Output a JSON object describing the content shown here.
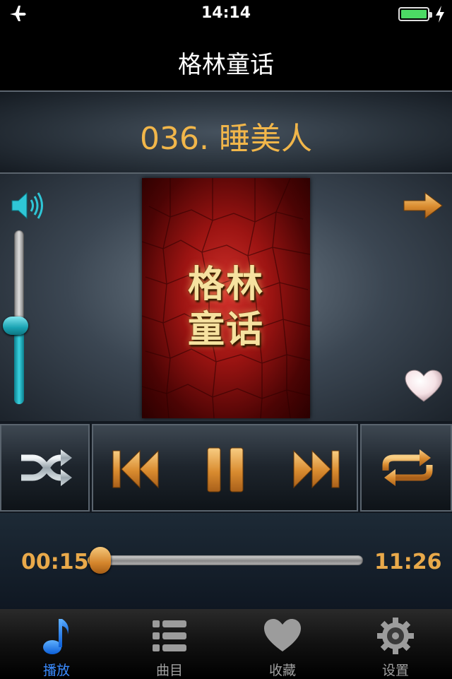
{
  "status_bar": {
    "time": "14:14"
  },
  "nav": {
    "title": "格林童话"
  },
  "track": {
    "title": "036. 睡美人"
  },
  "cover": {
    "line1": "格林",
    "line2": "童话"
  },
  "volume": {
    "level": 0.45
  },
  "progress": {
    "current": "00:15",
    "total": "11:26",
    "fraction": 0.022
  },
  "tabs": [
    {
      "label": "播放",
      "icon": "music-note-icon",
      "active": true
    },
    {
      "label": "曲目",
      "icon": "list-icon",
      "active": false
    },
    {
      "label": "收藏",
      "icon": "heart-icon",
      "active": false
    },
    {
      "label": "设置",
      "icon": "gear-icon",
      "active": false
    }
  ],
  "colors": {
    "accent": "#f1b64a",
    "volume": "#2fc6d6",
    "tab_active": "#3a8bff"
  }
}
